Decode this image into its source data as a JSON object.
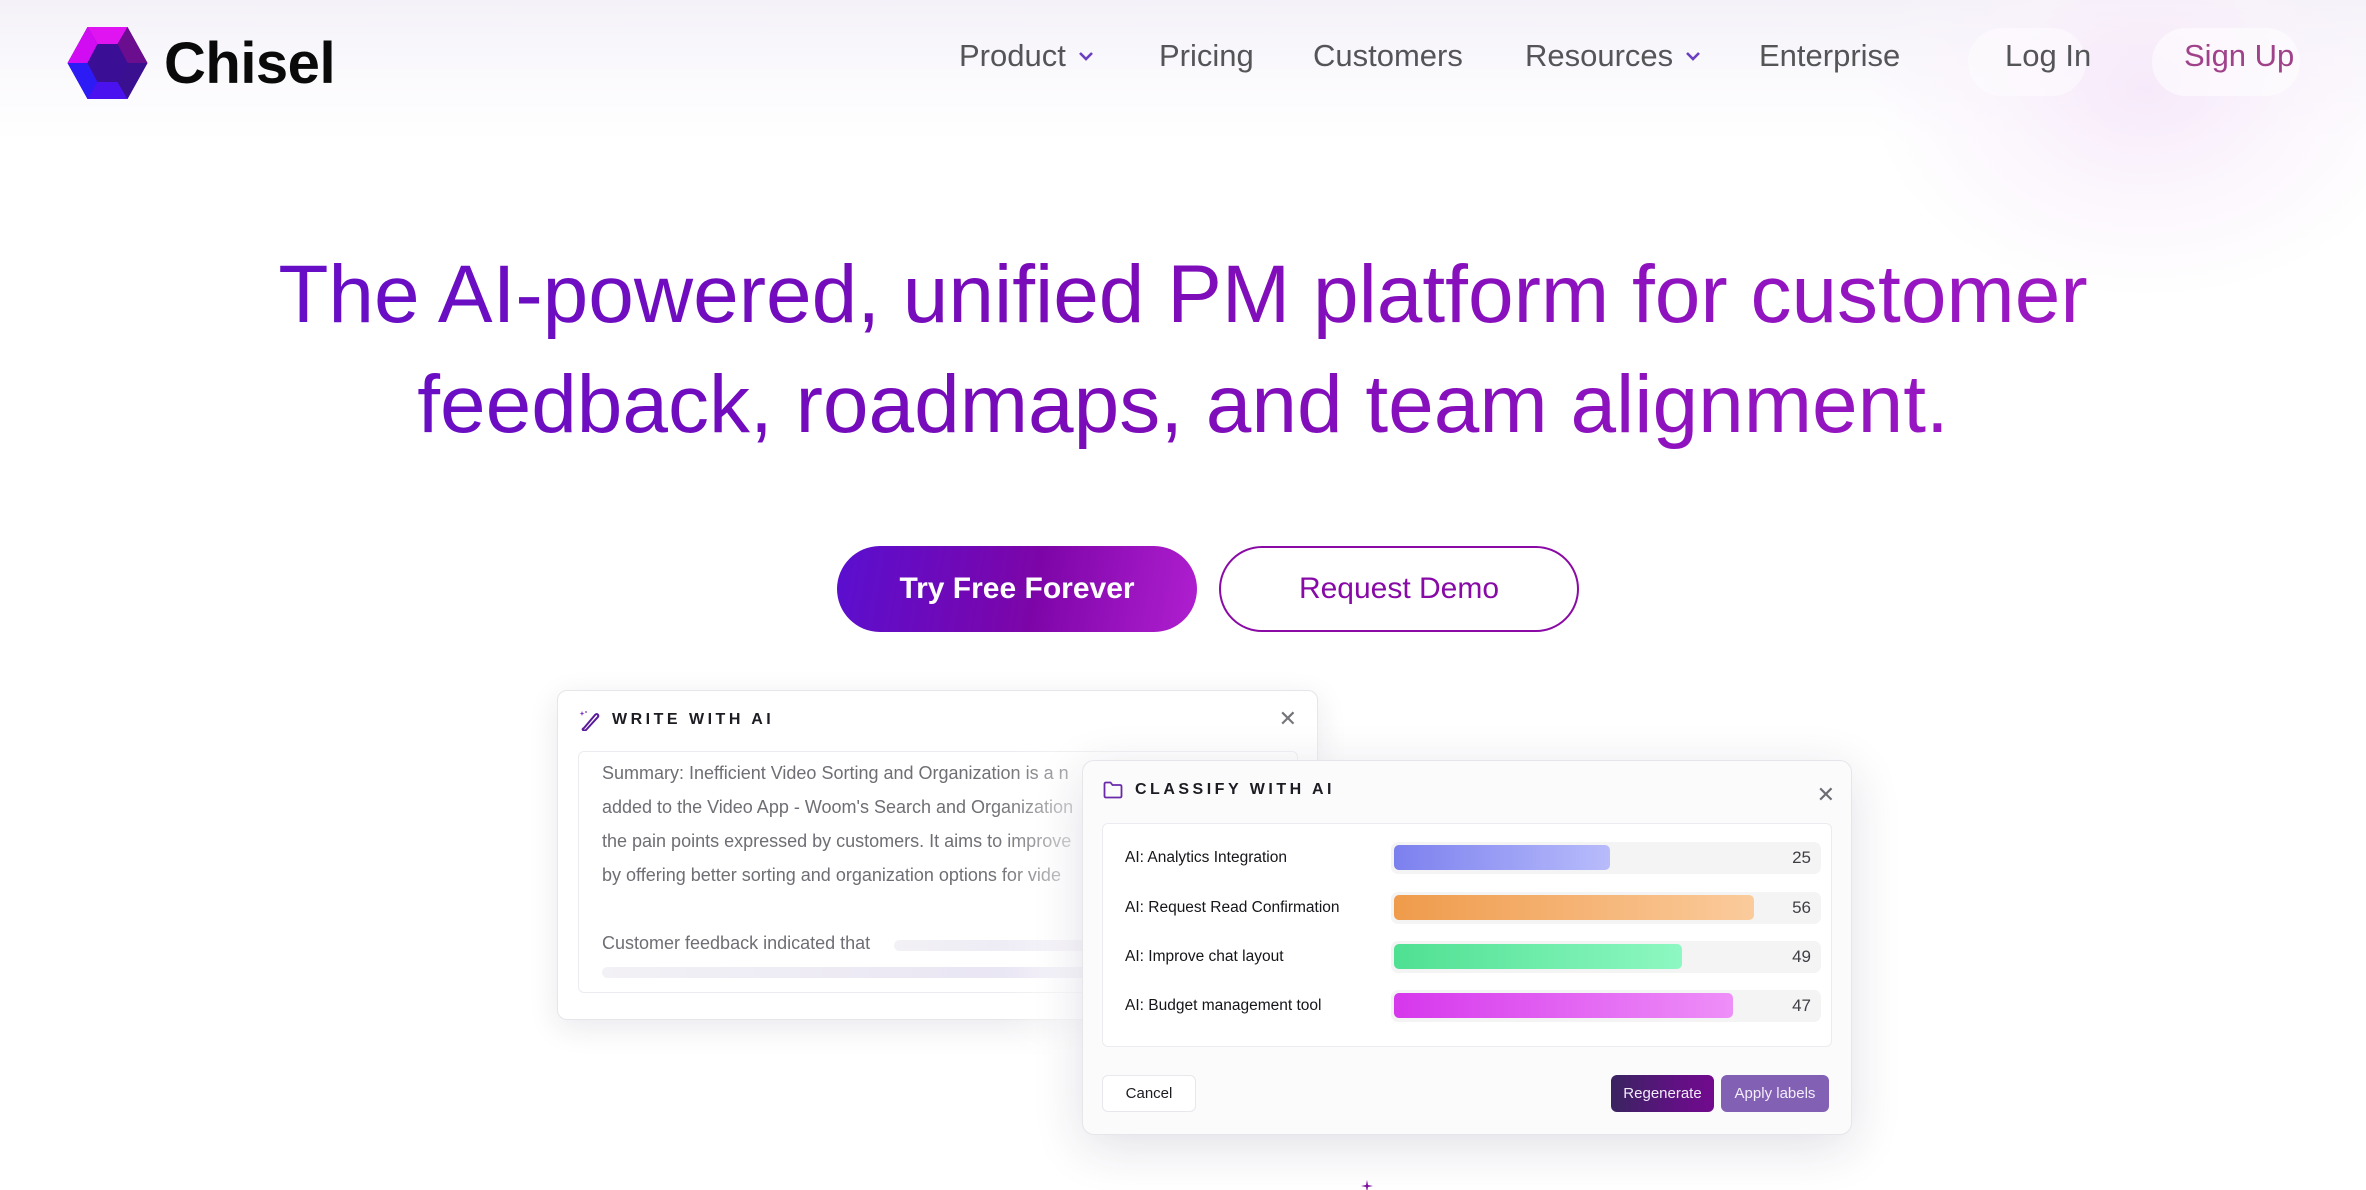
{
  "brand": {
    "name": "Chisel",
    "logo_icon": "hexagon-gem-icon"
  },
  "nav": {
    "items": [
      {
        "label": "Product",
        "has_dropdown": true
      },
      {
        "label": "Pricing",
        "has_dropdown": false
      },
      {
        "label": "Customers",
        "has_dropdown": false
      },
      {
        "label": "Resources",
        "has_dropdown": true
      },
      {
        "label": "Enterprise",
        "has_dropdown": false
      }
    ],
    "login_label": "Log In",
    "signup_label": "Sign Up",
    "colors": {
      "text": "#555558",
      "chevron": "#6a3fc0",
      "signup": "#a0428a"
    }
  },
  "hero": {
    "title_line1": "The AI-powered, unified PM platform for customer",
    "title_line2": "feedback, roadmaps, and team alignment.",
    "primary_cta": "Try Free Forever",
    "secondary_cta": "Request Demo",
    "colors": {
      "gradient_start": "#5f0fcc",
      "gradient_end": "#a51cc6"
    }
  },
  "write_modal": {
    "title": "WRITE WITH AI",
    "icon": "magic-wand-icon",
    "close_icon": "close-icon",
    "close_glyph": "✕",
    "lines": [
      "Summary: Inefficient Video Sorting and Organization is a n",
      "added to the Video App - Woom's Search and Organization",
      "the pain points expressed by customers. It aims to improve",
      "by offering better sorting and organization options for vide"
    ],
    "typing_line": "Customer feedback indicated that"
  },
  "classify_modal": {
    "title": "CLASSIFY WITH AI",
    "icon": "folder-icon",
    "close_glyph": "✕",
    "labels": [
      {
        "label": "AI: Analytics Integration",
        "count": "25",
        "fill_fraction": 0.51,
        "color_start": "#7c80ee",
        "color_end": "#b8bcfb"
      },
      {
        "label": "AI: Request Read Confirmation",
        "count": "56",
        "fill_fraction": 0.85,
        "color_start": "#ef9b4b",
        "color_end": "#fbcb9c"
      },
      {
        "label": "AI: Improve chat layout",
        "count": "49",
        "fill_fraction": 0.68,
        "color_start": "#4fe092",
        "color_end": "#8ef8c2"
      },
      {
        "label": "AI: Budget management tool",
        "count": "47",
        "fill_fraction": 0.8,
        "color_start": "#d637ec",
        "color_end": "#ee8ff8"
      }
    ],
    "cancel_label": "Cancel",
    "regenerate_label": "Regenerate",
    "apply_label": "Apply labels"
  }
}
